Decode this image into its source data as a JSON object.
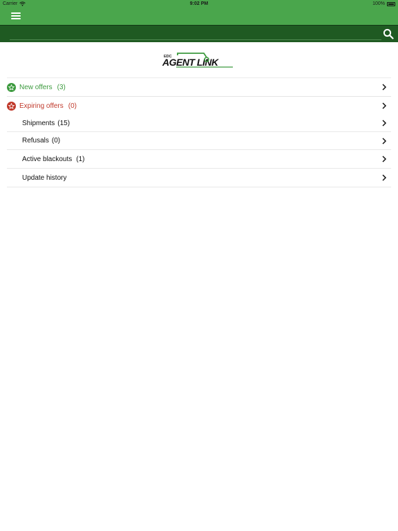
{
  "status_bar": {
    "carrier": "Carrier",
    "time": "9:02 PM",
    "battery": "100%"
  },
  "header": {
    "menu_icon": "hamburger-icon",
    "background_color": "#4aa64c"
  },
  "search": {
    "placeholder": "",
    "icon": "search-icon",
    "background_color": "#1f5a22"
  },
  "logo": {
    "small_text": "EDC",
    "main_text": "AGENT LINK"
  },
  "list": {
    "items": [
      {
        "label": "New offers",
        "count": "(3)",
        "icon": "star-badge-icon",
        "color": "#3c9a3e"
      },
      {
        "label": "Expiring offers",
        "count": "(0)",
        "icon": "star-badge-icon",
        "color": "#c0392b"
      },
      {
        "label": "Shipments",
        "count": "(15)"
      },
      {
        "label": "Refusals",
        "count": "(0)"
      },
      {
        "label": "Active blackouts",
        "count": "(1)"
      },
      {
        "label": "Update history",
        "count": ""
      }
    ]
  }
}
